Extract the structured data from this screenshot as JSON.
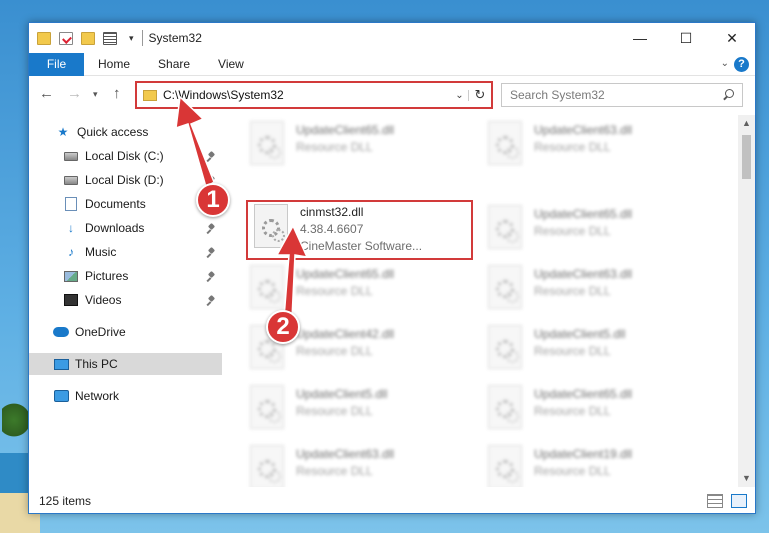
{
  "window": {
    "title": "System32",
    "controls": {
      "minimize": "—",
      "maximize": "☐",
      "close": "✕"
    }
  },
  "ribbon": {
    "tabs": [
      {
        "label": "File"
      },
      {
        "label": "Home"
      },
      {
        "label": "Share"
      },
      {
        "label": "View"
      }
    ],
    "help": "?"
  },
  "nav": {
    "address": "C:\\Windows\\System32",
    "search_placeholder": "Search System32"
  },
  "sidebar": {
    "items": [
      {
        "label": "Quick access",
        "icon": "star-icon",
        "pinned": false
      },
      {
        "label": "Local Disk (C:)",
        "icon": "disk-icon",
        "pinned": true
      },
      {
        "label": "Local Disk (D:)",
        "icon": "disk-icon",
        "pinned": true
      },
      {
        "label": "Documents",
        "icon": "documents-icon",
        "pinned": true
      },
      {
        "label": "Downloads",
        "icon": "download-icon",
        "pinned": true
      },
      {
        "label": "Music",
        "icon": "music-icon",
        "pinned": true
      },
      {
        "label": "Pictures",
        "icon": "pictures-icon",
        "pinned": true
      },
      {
        "label": "Videos",
        "icon": "video-icon",
        "pinned": true
      },
      {
        "label": "OneDrive",
        "icon": "cloud-icon",
        "pinned": false
      },
      {
        "label": "This PC",
        "icon": "pc-icon",
        "pinned": false,
        "selected": true
      },
      {
        "label": "Network",
        "icon": "network-icon",
        "pinned": false
      }
    ]
  },
  "files": {
    "focused": {
      "name": "cinmst32.dll",
      "version": "4.38.4.6607",
      "company": "CineMaster Software..."
    },
    "left_column": [
      {
        "name": "UpdateClient65.dll",
        "type": "Resource DLL"
      },
      {
        "name": "UpdateClient65.dll",
        "type": "Resource DLL"
      },
      {
        "name": "UpdateClient42.dll",
        "type": "Resource DLL"
      },
      {
        "name": "UpdateClient5.dll",
        "type": "Resource DLL"
      },
      {
        "name": "UpdateClient63.dll",
        "type": "Resource DLL"
      }
    ],
    "right_column": [
      {
        "name": "UpdateClient63.dll",
        "type": "Resource DLL"
      },
      {
        "name": "UpdateClient65.dll",
        "type": "Resource DLL"
      },
      {
        "name": "UpdateClient63.dll",
        "type": "Resource DLL"
      },
      {
        "name": "UpdateClient5.dll",
        "type": "Resource DLL"
      },
      {
        "name": "UpdateClient65.dll",
        "type": "Resource DLL"
      },
      {
        "name": "UpdateClient19.dll",
        "type": "Resource DLL"
      }
    ]
  },
  "status": {
    "item_count": "125 items"
  },
  "annotations": {
    "step1": "1",
    "step2": "2",
    "color": "#d93636"
  }
}
